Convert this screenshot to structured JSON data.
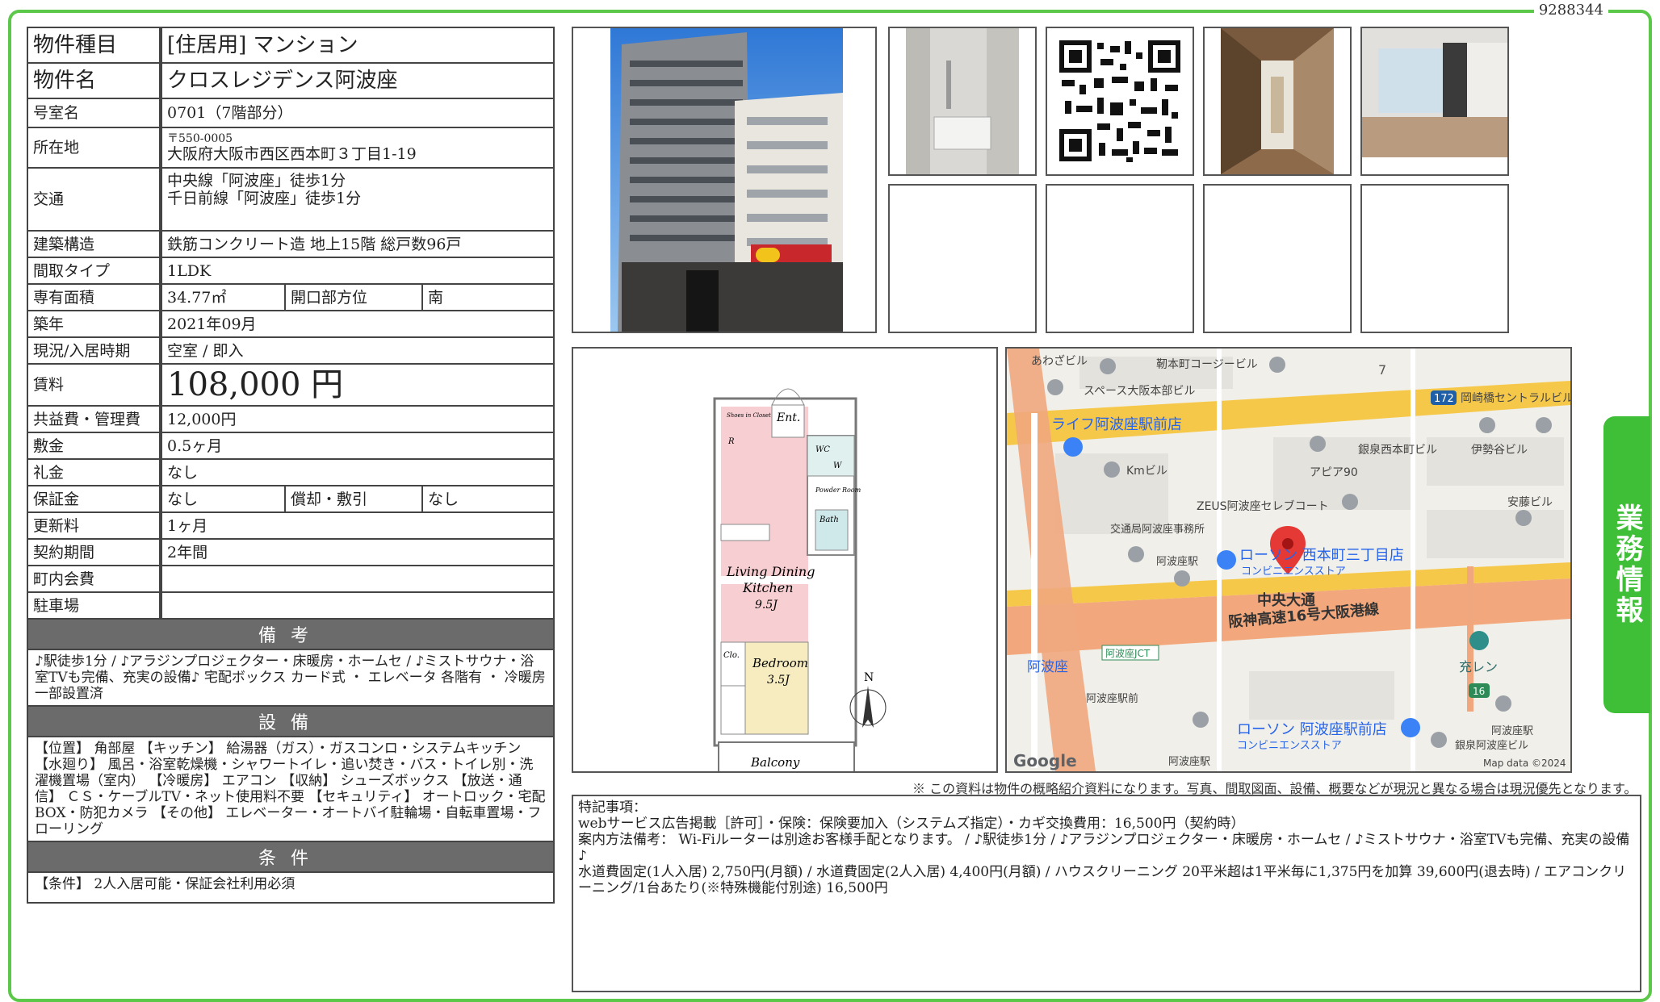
{
  "doc_number": "9288344",
  "side_tab": "業務情報",
  "rows": {
    "type": {
      "label": "物件種目",
      "value": "[住居用]  マンション"
    },
    "name": {
      "label": "物件名",
      "value": "クロスレジデンス阿波座"
    },
    "room": {
      "label": "号室名",
      "value": "0701（7階部分）"
    },
    "address": {
      "label": "所在地",
      "zip": "〒550-0005",
      "value": "大阪府大阪市西区西本町３丁目1-19"
    },
    "transport": {
      "label": "交通",
      "line1": "中央線「阿波座」徒歩1分",
      "line2": "千日前線「阿波座」徒歩1分"
    },
    "structure": {
      "label": "建築構造",
      "value": "鉄筋コンクリート造 地上15階 総戸数96戸"
    },
    "layout": {
      "label": "間取タイプ",
      "value": "1LDK"
    },
    "area": {
      "label": "専有面積",
      "value": "34.77㎡",
      "label2": "開口部方位",
      "value2": "南"
    },
    "built": {
      "label": "築年",
      "value": "2021年09月"
    },
    "status": {
      "label": "現況/入居時期",
      "value": "空室 / 即入"
    },
    "rent": {
      "label": "賃料",
      "value": "108,000 円"
    },
    "fee": {
      "label": "共益費・管理費",
      "value": "12,000円"
    },
    "deposit": {
      "label": "敷金",
      "value": "0.5ヶ月"
    },
    "key_money": {
      "label": "礼金",
      "value": "なし"
    },
    "guarantee": {
      "label": "保証金",
      "value": "なし",
      "label2": "償却・敷引",
      "value2": "なし"
    },
    "renewal": {
      "label": "更新料",
      "value": "1ヶ月"
    },
    "contract": {
      "label": "契約期間",
      "value": "2年間"
    },
    "town_fee": {
      "label": "町内会費",
      "value": ""
    },
    "parking": {
      "label": "駐車場",
      "value": ""
    }
  },
  "remarks": {
    "title": "備考",
    "text": "♪駅徒歩1分 / ♪アラジンプロジェクター・床暖房・ホームセ / ♪ミストサウナ・浴室TVも完備、充実の設備♪ 宅配ボックス カード式 ・ エレベータ 各階有 ・ 冷暖房 一部設置済"
  },
  "equipment": {
    "title": "設備",
    "text": "【位置】 角部屋 【キッチン】 給湯器（ガス）・ガスコンロ・システムキッチン 【水廻り】 風呂・浴室乾燥機・シャワートイレ・追い焚き・バス・トイレ別・洗濯機置場（室内） 【冷暖房】 エアコン 【収納】 シューズボックス 【放送・通信】 ＣＳ・ケーブルTV・ネット使用料不要 【セキュリティ】 オートロック・宅配BOX・防犯カメラ 【その他】 エレベーター・オートバイ駐輪場・自転車置場・フローリング"
  },
  "conditions": {
    "title": "条件",
    "text": "【条件】 2人入居可能・保証会社利用必須"
  },
  "floorplan": {
    "storage": "Shoes in Closet",
    "ent": "Ent.",
    "wc": "WC",
    "w": "W",
    "r": "R",
    "powder": "Powder Room",
    "bath": "Bath",
    "ldk_line1": "Living Dining",
    "ldk_line2": "Kitchen",
    "ldk_size": "9.5J",
    "clo": "Clo.",
    "bed": "Bedroom",
    "bed_size": "3.5J",
    "balcony": "Balcony",
    "north": "N"
  },
  "map": {
    "labels": [
      "あわざビル",
      "靭本町コージービル",
      "スペース大阪本部ビル",
      "岡崎橋セントラルビル",
      "ライフ阿波座駅前店",
      "銀泉西本町ビル",
      "伊勢谷ビル",
      "Kmビル",
      "アピア90",
      "ZEUS阿波座セレブコート",
      "安藤ビル",
      "交通局阿波座事務所",
      "阿波座駅",
      "ローソン 西本町三丁目店",
      "コンビニエンスストア",
      "中央大通",
      "阪神高速16号大阪港線",
      "阿波座JCT",
      "阿波座",
      "阿波座駅前",
      "充レン",
      "ローソン 阿波座駅前店",
      "コンビニエンスストア",
      "阿波座駅",
      "阿波座駅",
      "銀泉阿波座ビル"
    ],
    "route_172": "172",
    "route_16": "16",
    "route_7": "7",
    "google": "Google",
    "attribution": "Map data ©2024"
  },
  "disclaimer": "※ この資料は物件の概略紹介資料になります。写真、間取図面、設備、概要などが現況と異なる場合は現況優先となります。",
  "notes": {
    "title": "特記事項：",
    "line1": "webサービス広告掲載［許可］・保険：保険要加入（システムズ指定）・カギ交換費用：16,500円（契約時）",
    "line2": "案内方法備考： Wi-Fiルーターは別途お客様手配となります。 / ♪駅徒歩1分 / ♪アラジンプロジェクター・床暖房・ホームセ / ♪ミストサウナ・浴室TVも完備、充実の設備♪",
    "line3": "水道費固定(1人入居) 2,750円(月額) / 水道費固定(2人入居) 4,400円(月額) / ハウスクリーニング 20平米超は1平米毎に1,375円を加算 39,600円(退去時) / エアコンクリーニング/1台あたり(※特殊機能付別途) 16,500円"
  },
  "colors": {
    "frame": "#5cc84a",
    "tab": "#3fbf37",
    "section_header": "#6b6b6b"
  }
}
